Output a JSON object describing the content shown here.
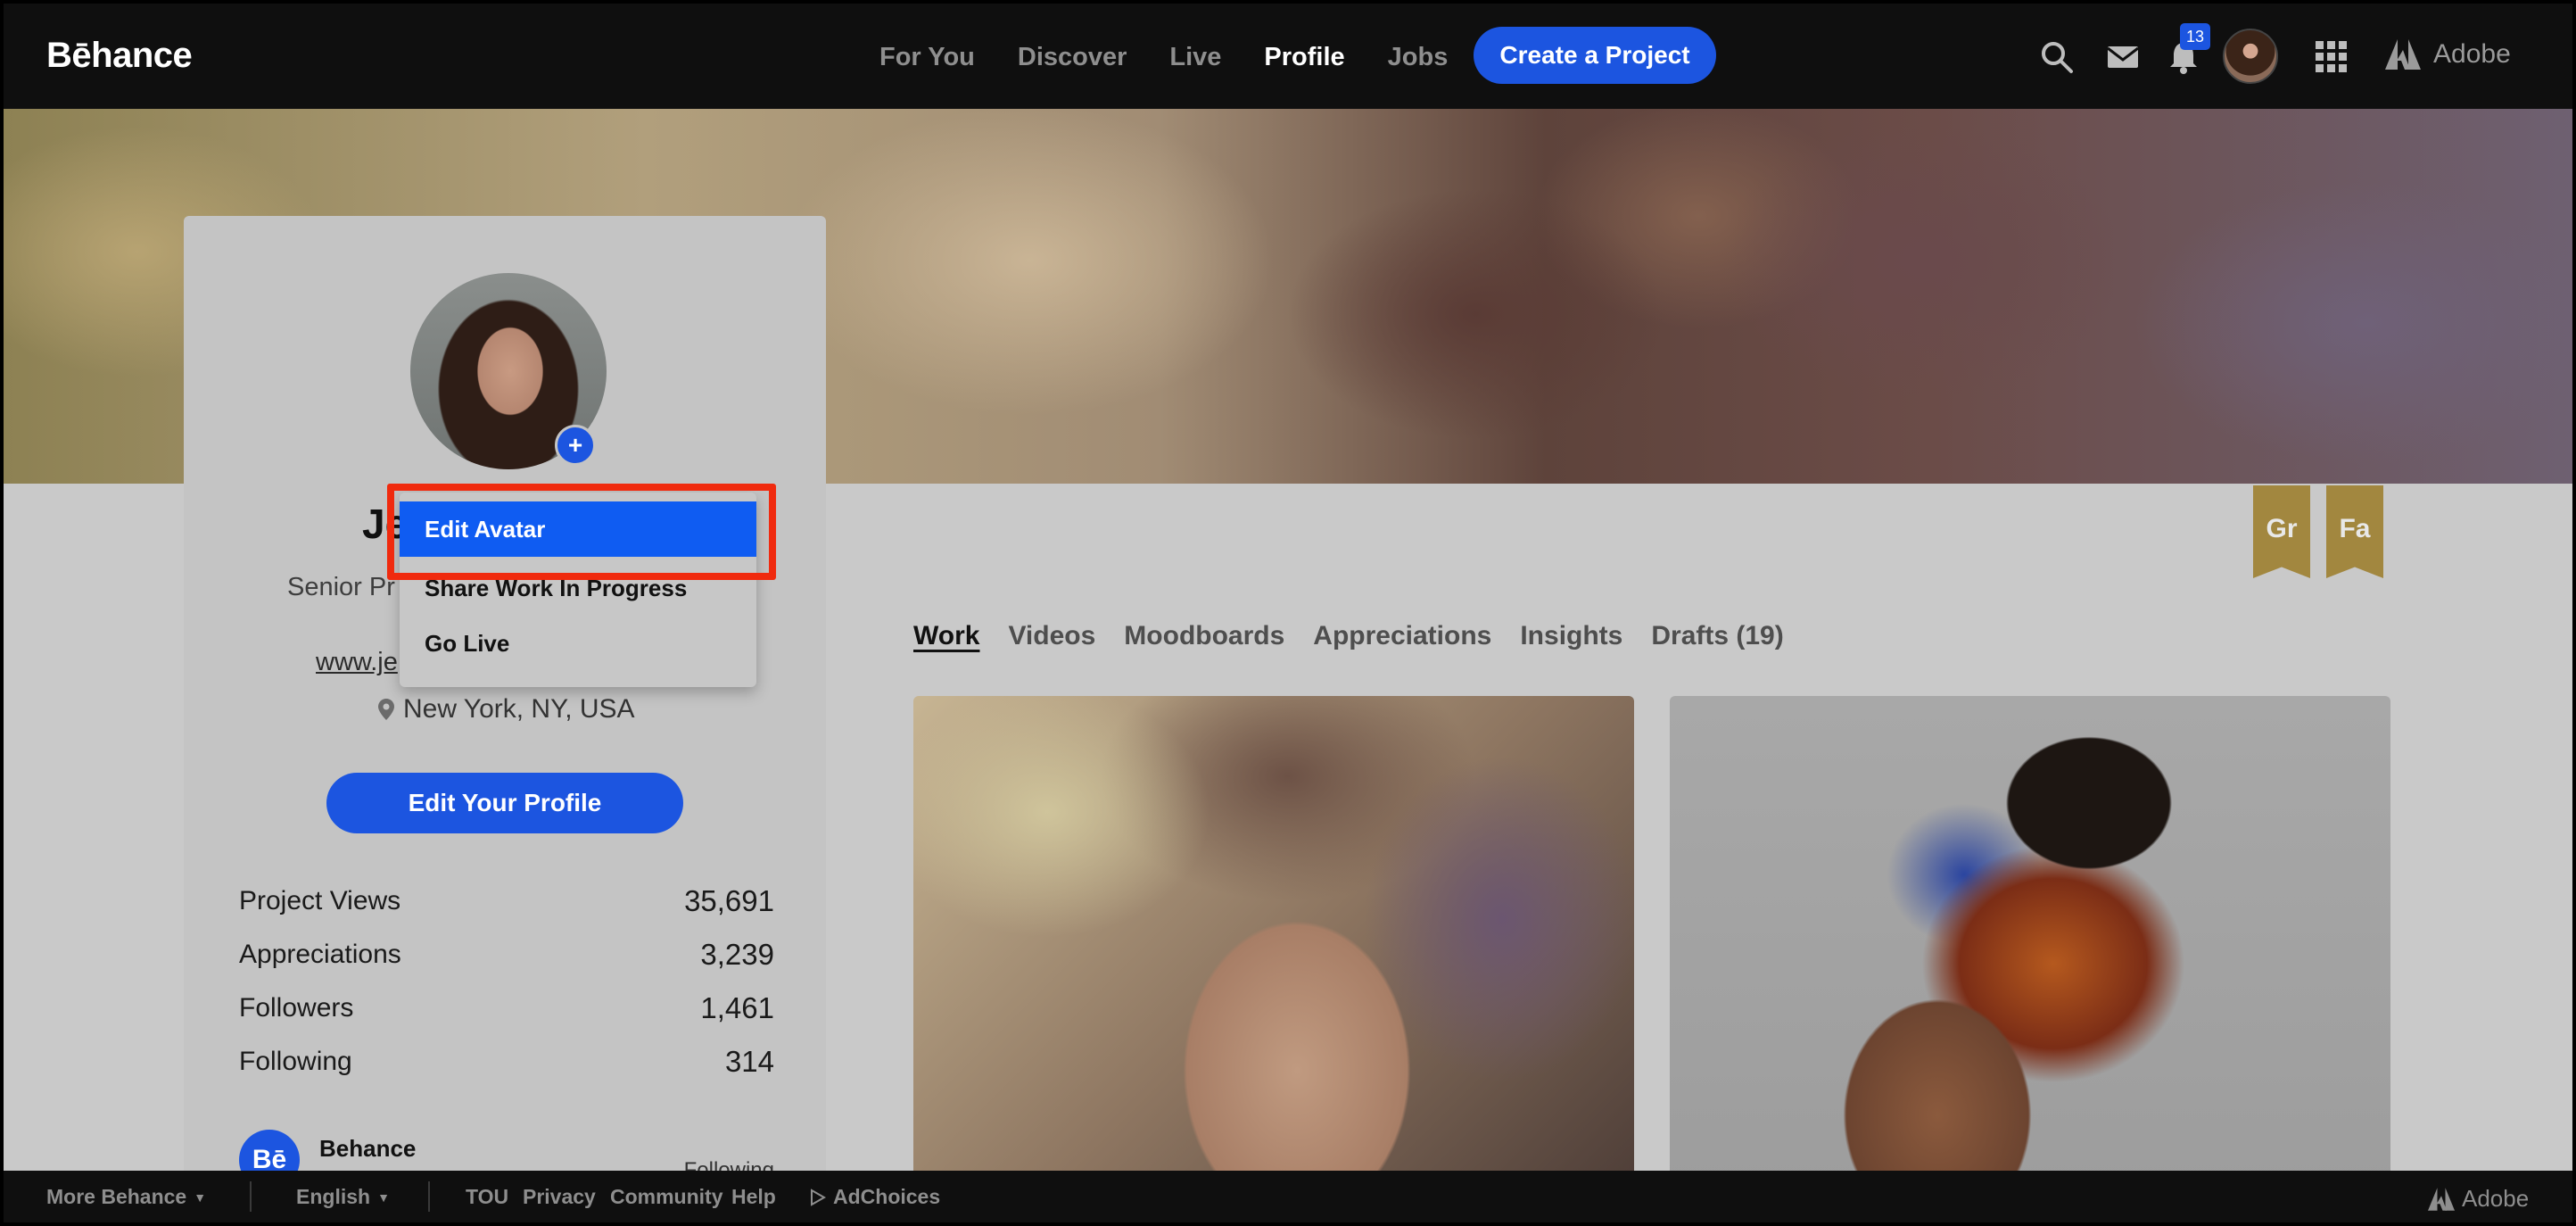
{
  "nav": {
    "logo": "Bēhance",
    "links": [
      "For You",
      "Discover",
      "Live",
      "Profile",
      "Jobs"
    ],
    "active": "Profile",
    "create_label": "Create a Project",
    "notification_count": "13",
    "adobe_label": "Adobe"
  },
  "profile": {
    "name_visible": "Je",
    "occupation_visible": "Senior Pr",
    "url_visible": "www.je",
    "location": "New York, NY, USA",
    "edit_label": "Edit Your Profile",
    "stats": [
      {
        "label": "Project Views",
        "value": "35,691"
      },
      {
        "label": "Appreciations",
        "value": "3,239"
      },
      {
        "label": "Followers",
        "value": "1,461"
      },
      {
        "label": "Following",
        "value": "314"
      }
    ],
    "team": {
      "icon_text": "Bē",
      "name": "Behance",
      "status": "Following"
    }
  },
  "dropdown": {
    "items": [
      "Edit Avatar",
      "Share Work In Progress",
      "Go Live"
    ],
    "selected": "Edit Avatar"
  },
  "badges": [
    "Gr",
    "Fa"
  ],
  "tabs": [
    "Work",
    "Videos",
    "Moodboards",
    "Appreciations",
    "Insights",
    "Drafts (19)"
  ],
  "active_tab": "Work",
  "footer": {
    "more": "More Behance",
    "language": "English",
    "links": [
      "TOU",
      "Privacy",
      "Community",
      "Help"
    ],
    "adchoices": "AdChoices",
    "adobe_label": "Adobe"
  },
  "colors": {
    "accent": "#1c55e0",
    "highlight": "#f02a0e",
    "badge": "#a2873f"
  }
}
